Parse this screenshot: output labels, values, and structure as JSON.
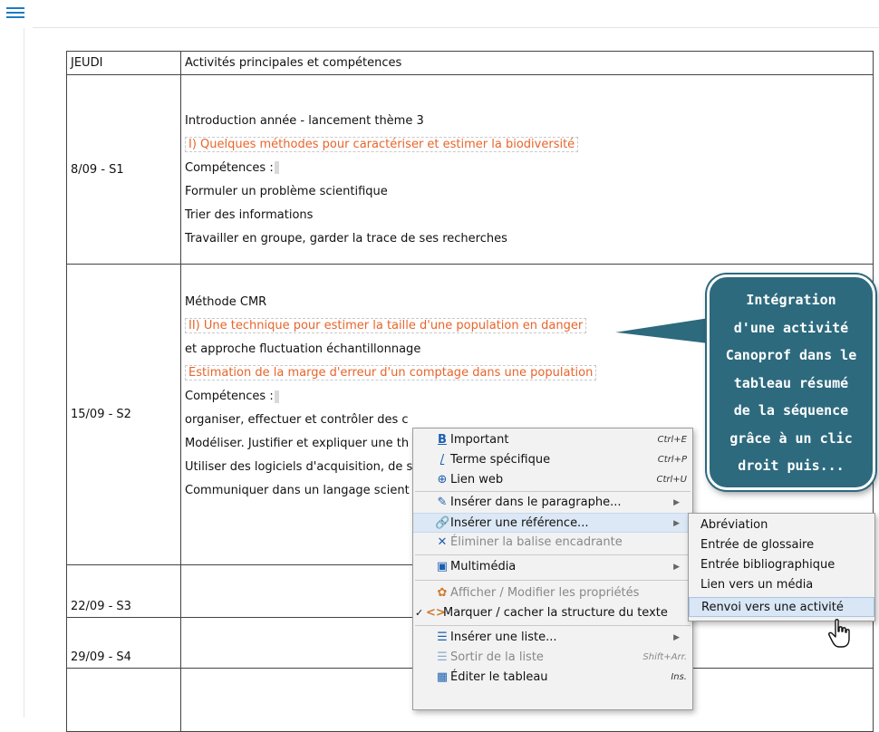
{
  "table": {
    "header": {
      "day": "JEUDI",
      "activities": "Activités principales et compétences"
    },
    "rows": [
      {
        "day": "8/09 - S1",
        "lines": [
          "Introduction année - lancement thème 3",
          "I) Quelques méthodes pour caractériser et estimer la biodiversité",
          "Compétences :",
          "Formuler un problème scientifique",
          "Trier des informations",
          "Travailler en groupe, garder la trace de ses recherches"
        ]
      },
      {
        "day": "15/09 - S2",
        "lines": [
          "Méthode CMR",
          "II) Une technique pour estimer la taille d'une population en danger",
          "et approche fluctuation échantillonnage",
          "Estimation de la marge d'erreur d'un comptage dans une population",
          "Compétences :",
          "organiser, effectuer et contrôler des c",
          "Modéliser. Justifier et expliquer une th",
          "Utiliser des logiciels d'acquisition, de s",
          "Communiquer dans un langage scient"
        ]
      },
      {
        "day": "22/09 - S3"
      },
      {
        "day": "29/09 - S4"
      },
      {
        "day": ""
      }
    ]
  },
  "callout": {
    "lines": [
      "Intégration",
      "d'une activité",
      "Canoprof dans le",
      "tableau résumé",
      "de la séquence",
      "grâce à un clic",
      "droit puis..."
    ]
  },
  "context_menu": {
    "items": [
      {
        "label": "Important",
        "shortcut": "Ctrl+E",
        "icon": "bold-b-icon"
      },
      {
        "label": "Terme spécifique",
        "shortcut": "Ctrl+P",
        "icon": "italic-slash-icon"
      },
      {
        "label": "Lien web",
        "shortcut": "Ctrl+U",
        "icon": "globe-icon"
      },
      {
        "label": "Insérer dans le paragraphe...",
        "icon": "pencil-icon",
        "has_submenu": true
      },
      {
        "label": "Insérer une référence...",
        "icon": "link-icon",
        "has_submenu": true,
        "highlighted": true
      },
      {
        "label": "Éliminer la balise encadrante",
        "icon": "remove-x-icon",
        "disabled": true
      },
      {
        "label": "Multimédia",
        "icon": "image-icon",
        "has_submenu": true
      },
      {
        "label": "Afficher / Modifier les propriétés",
        "icon": "properties-icon",
        "disabled": true
      },
      {
        "label": "Marquer / cacher la structure du texte",
        "icon": "code-brackets-icon",
        "checked": true,
        "check": "✓"
      },
      {
        "label": "Insérer une liste...",
        "icon": "list-icon",
        "has_submenu": true
      },
      {
        "label": "Sortir de la liste",
        "shortcut": "Shift+Arr.",
        "icon": "outdent-list-icon",
        "disabled": true
      },
      {
        "label": "Éditer le tableau",
        "shortcut": "Ins.",
        "icon": "table-icon"
      }
    ]
  },
  "submenu": {
    "items": [
      {
        "label": "Abréviation"
      },
      {
        "label": "Entrée de glossaire"
      },
      {
        "label": "Entrée bibliographique"
      },
      {
        "label": "Lien vers un média"
      },
      {
        "label": "Renvoi vers une activité",
        "highlighted": true
      }
    ]
  },
  "colors": {
    "orange_text": "#e8642a",
    "callout_bg": "#2d6a7e",
    "menu_bg": "#f2f2f2",
    "highlight": "#dce8f5",
    "accent_blue": "#1c7cc1"
  }
}
